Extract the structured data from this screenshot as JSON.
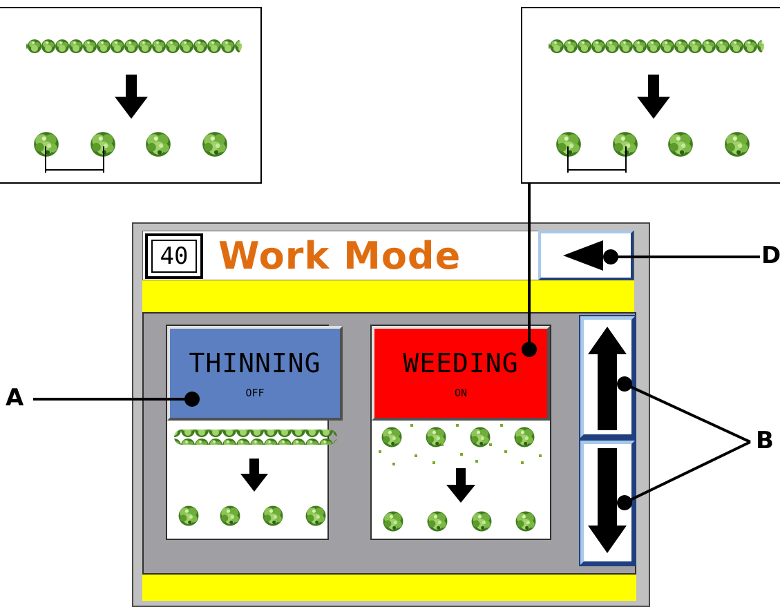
{
  "screen": {
    "page_number": "40",
    "title": "Work Mode",
    "back_icon": "left-triangle-icon"
  },
  "modes": [
    {
      "label": "THINNING",
      "status": "OFF",
      "color": "#5b7fc0"
    },
    {
      "label": "WEEDING",
      "status": "ON",
      "color": "#ff0000"
    }
  ],
  "scroll_buttons": {
    "up_icon": "arrow-up-icon",
    "down_icon": "arrow-down-icon"
  },
  "callouts": {
    "a": "A",
    "b": "B",
    "d": "D"
  },
  "colors": {
    "title": "#e06c10",
    "strip": "#ffff00",
    "frame": "#c0c0c0",
    "content_bg": "#a0a0a4"
  }
}
